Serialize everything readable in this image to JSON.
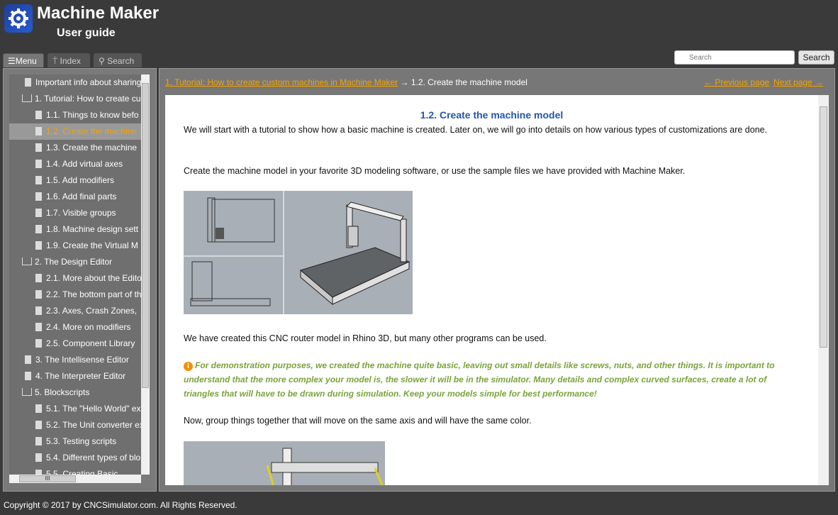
{
  "header": {
    "app_title": "Machine Maker",
    "subtitle": "User guide",
    "logo_icon": "gear-icon"
  },
  "tabs": [
    {
      "label": "Menu",
      "icon": "list-icon",
      "active": true
    },
    {
      "label": "Index",
      "icon": "pin-icon",
      "active": false
    },
    {
      "label": "Search",
      "icon": "search-icon",
      "active": false
    }
  ],
  "search": {
    "placeholder": "Search",
    "button_label": "Search"
  },
  "toc": {
    "items": [
      {
        "label": "Important info about sharing",
        "type": "page",
        "indent": 1
      },
      {
        "label": "1. Tutorial: How to create cu",
        "type": "book",
        "indent": 0
      },
      {
        "label": "1.1. Things to know befo",
        "type": "page",
        "indent": 2
      },
      {
        "label": "1.2. Create the machine",
        "type": "page",
        "indent": 2,
        "selected": true
      },
      {
        "label": "1.3. Create the machine",
        "type": "page",
        "indent": 2
      },
      {
        "label": "1.4. Add virtual axes",
        "type": "page",
        "indent": 2
      },
      {
        "label": "1.5. Add modifiers",
        "type": "page",
        "indent": 2
      },
      {
        "label": "1.6. Add final parts",
        "type": "page",
        "indent": 2
      },
      {
        "label": "1.7. Visible groups",
        "type": "page",
        "indent": 2
      },
      {
        "label": "1.8. Machine design sett",
        "type": "page",
        "indent": 2
      },
      {
        "label": "1.9. Create the Virtual M",
        "type": "page",
        "indent": 2
      },
      {
        "label": "2. The Design Editor",
        "type": "book",
        "indent": 0
      },
      {
        "label": "2.1. More about the Edito",
        "type": "page",
        "indent": 2
      },
      {
        "label": "2.2. The bottom part of th",
        "type": "page",
        "indent": 2
      },
      {
        "label": "2.3. Axes, Crash Zones,",
        "type": "page",
        "indent": 2
      },
      {
        "label": "2.4. More on modifiers",
        "type": "page",
        "indent": 2
      },
      {
        "label": "2.5. Component Library",
        "type": "page",
        "indent": 2
      },
      {
        "label": "3. The Intellisense Editor",
        "type": "page",
        "indent": 1
      },
      {
        "label": "4. The Interpreter Editor",
        "type": "page",
        "indent": 1
      },
      {
        "label": "5. Blockscripts",
        "type": "book",
        "indent": 0
      },
      {
        "label": "5.1. The \"Hello World\" ex",
        "type": "page",
        "indent": 2
      },
      {
        "label": "5.2. The Unit converter ex",
        "type": "page",
        "indent": 2
      },
      {
        "label": "5.3. Testing scripts",
        "type": "page",
        "indent": 2
      },
      {
        "label": "5.4. Different types of blo",
        "type": "page",
        "indent": 2
      },
      {
        "label": "5.5. Creating Basic",
        "type": "page",
        "indent": 2
      }
    ]
  },
  "breadcrumb": {
    "parent": "1. Tutorial: How to create custom machines in Machine Maker",
    "separator": "→",
    "current": "1.2. Create the machine model"
  },
  "nav": {
    "prev": "← Previous page",
    "next": "Next page →"
  },
  "article": {
    "title": "1.2. Create the machine model",
    "para1": "We will start with a tutorial to show how a basic machine is created. Later on, we will go into details on how various types of customizations are done.",
    "para2": "Create the machine model in your favorite 3D modeling software, or use the sample files we have provided with Machine Maker.",
    "para3": "We have created this CNC router model in Rhino 3D, but many other programs can be used.",
    "note": "For demonstration purposes, we created the machine quite basic, leaving out small details like screws, nuts, and other things. It is important to understand that the more complex your model is, the slower it will be in the simulator. Many details and complex curved surfaces, create a lot of triangles that will have to be drawn during simulation. Keep your models simple for best performance!",
    "para4": "Now, group things together that will move on the same axis and will have the same color."
  },
  "footer": "Copyright © 2017 by CNCSimulator.com. All Rights Reserved."
}
